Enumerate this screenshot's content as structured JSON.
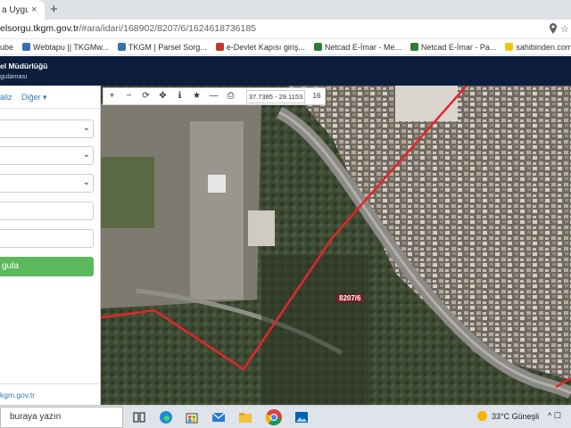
{
  "browser": {
    "tab_title": "a Uygula",
    "tab_close": "×",
    "new_tab": "+",
    "url_host": "elsorgu.tkgm.gov.tr",
    "url_path": "/#ara/idari/168902/8207/6/1624618736185"
  },
  "bookmarks": [
    {
      "label": "ube",
      "color": "#e8b94a"
    },
    {
      "label": "Webtapu || TKGMw...",
      "color": "#3a6fb0"
    },
    {
      "label": "TKGM | Parsel Sorg...",
      "color": "#3a6fb0"
    },
    {
      "label": "e-Devlet Kapısı giriş...",
      "color": "#c0392b"
    },
    {
      "label": "Netcad E-İmar - Me...",
      "color": "#2e7d32"
    },
    {
      "label": "Netcad E-İmar - Pa...",
      "color": "#2e7d32"
    },
    {
      "label": "sahibinden.com an...",
      "color": "#f1c40f"
    }
  ],
  "header": {
    "line1": "el Müdürlüğü",
    "line2": "gulaması"
  },
  "sidebar": {
    "tab1": "aliz",
    "tab2": "Diğer ▾",
    "query_button": "gula",
    "footer": "kgm.gov.tr"
  },
  "map": {
    "coords": "37.7385 - 29.1153",
    "zoom": "16",
    "parcel_label": "8207/6"
  },
  "taskbar": {
    "search": "buraya yazın",
    "weather": "33°C  Güneşli",
    "tray": "^ ☐"
  },
  "colors": {
    "header_bg": "#0d1e3d",
    "query_green": "#5cb85c",
    "parcel_line": "#e3262c"
  }
}
